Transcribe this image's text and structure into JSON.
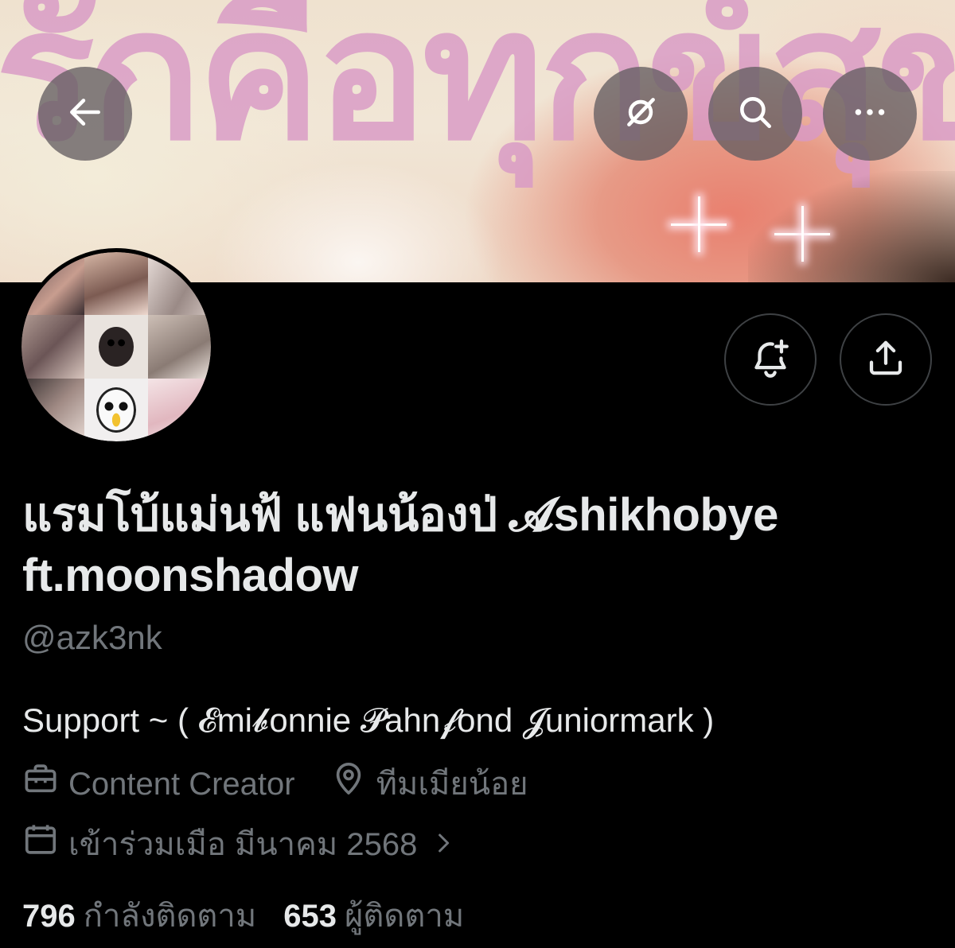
{
  "banner": {
    "text": "รักคือทุกข์สุขคือเก"
  },
  "header_buttons": {
    "back": "arrow-left-icon",
    "grok": "grok-icon",
    "search": "search-icon",
    "more": "more-horizontal-icon"
  },
  "profile": {
    "display_name": "แรมโบ้แม่นฟ้ แฟนน้องป่ 𝓐shikhobye ft.moonshadow",
    "handle": "@azk3nk",
    "bio": "Support ~ ( 𝓔mi𝓫onnie 𝓟ahn𝓯ond 𝓙uniormark )",
    "category": "Content Creator",
    "location": "ทีมเมียน้อย",
    "joined": "เข้าร่วมเมือ มีนาคม 2568"
  },
  "actions": {
    "notify": "bell-plus-icon",
    "share": "share-icon"
  },
  "stats": {
    "following_count": "796",
    "following_label": "กำลังติดตาม",
    "followers_count": "653",
    "followers_label": "ผู้ติดตาม"
  },
  "colors": {
    "background": "#000000",
    "primary_text": "#e7e9ea",
    "secondary_text": "#71767b",
    "overlay_button": "#645e61",
    "outline": "#3e4144",
    "banner_text": "#d99ac6"
  }
}
